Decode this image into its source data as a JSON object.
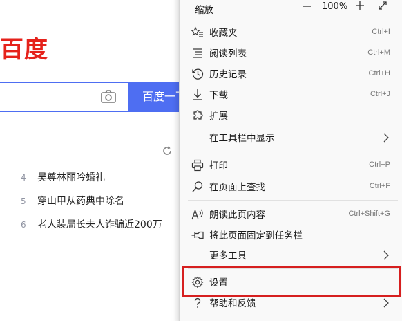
{
  "page": {
    "logo_text": "百度",
    "search_button_label": "百度一下",
    "hot_items": [
      {
        "rank": "4",
        "title": "吴尊林丽吟婚礼"
      },
      {
        "rank": "5",
        "title": "穿山甲从药典中除名"
      },
      {
        "rank": "6",
        "title": "老人装局长夫人诈骗近200万"
      }
    ]
  },
  "menu": {
    "zoom": {
      "label": "缩放",
      "value": "100%"
    },
    "items": [
      {
        "label": "收藏夹",
        "shortcut": "Ctrl+I",
        "icon": "favorites-icon"
      },
      {
        "label": "阅读列表",
        "shortcut": "Ctrl+M",
        "icon": "reading-list-icon"
      },
      {
        "label": "历史记录",
        "shortcut": "Ctrl+H",
        "icon": "history-icon"
      },
      {
        "label": "下载",
        "shortcut": "Ctrl+J",
        "icon": "download-icon"
      },
      {
        "label": "扩展",
        "shortcut": "",
        "icon": "extensions-icon"
      },
      {
        "label": "在工具栏中显示",
        "shortcut": "",
        "icon": "chevron-right-icon"
      },
      {
        "label": "打印",
        "shortcut": "Ctrl+P",
        "icon": "print-icon"
      },
      {
        "label": "在页面上查找",
        "shortcut": "Ctrl+F",
        "icon": "find-icon"
      },
      {
        "label": "朗读此页内容",
        "shortcut": "Ctrl+Shift+G",
        "icon": "read-aloud-icon"
      },
      {
        "label": "将此页面固定到任务栏",
        "shortcut": "",
        "icon": "pin-icon"
      },
      {
        "label": "更多工具",
        "shortcut": "",
        "icon": "chevron-right-icon"
      },
      {
        "label": "设置",
        "shortcut": "",
        "icon": "gear-icon"
      },
      {
        "label": "帮助和反馈",
        "shortcut": "",
        "icon": "help-icon"
      }
    ]
  },
  "colors": {
    "baidu_red": "#e5221b",
    "baidu_blue": "#4e6ef2",
    "highlight_red": "#d61f1f"
  }
}
